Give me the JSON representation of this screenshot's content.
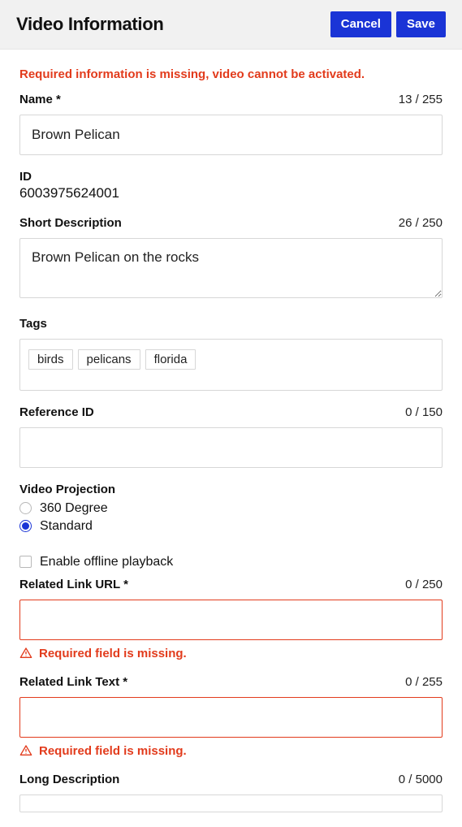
{
  "header": {
    "title": "Video Information",
    "cancel": "Cancel",
    "save": "Save"
  },
  "banner": "Required information is missing, video cannot be activated.",
  "name": {
    "label": "Name *",
    "value": "Brown Pelican",
    "counter": "13 / 255"
  },
  "id": {
    "label": "ID",
    "value": "6003975624001"
  },
  "short_desc": {
    "label": "Short Description",
    "value": "Brown Pelican on the rocks",
    "counter": "26 / 250"
  },
  "tags": {
    "label": "Tags",
    "items": [
      "birds",
      "pelicans",
      "florida"
    ]
  },
  "reference_id": {
    "label": "Reference ID",
    "value": "",
    "counter": "0 / 150"
  },
  "projection": {
    "label": "Video Projection",
    "options": [
      {
        "label": "360 Degree",
        "selected": false
      },
      {
        "label": "Standard",
        "selected": true
      }
    ]
  },
  "offline": {
    "label": "Enable offline playback",
    "checked": false
  },
  "link_url": {
    "label": "Related Link URL *",
    "value": "",
    "counter": "0 / 250",
    "error": "Required field is missing."
  },
  "link_text": {
    "label": "Related Link Text *",
    "value": "",
    "counter": "0 / 255",
    "error": "Required field is missing."
  },
  "long_desc": {
    "label": "Long Description",
    "value": "",
    "counter": "0 / 5000"
  }
}
